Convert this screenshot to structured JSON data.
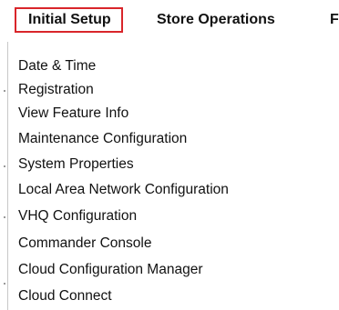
{
  "menubar": {
    "tabs": [
      {
        "label": "Initial Setup",
        "active": true
      },
      {
        "label": "Store Operations",
        "active": false
      },
      {
        "label": "F",
        "active": false
      }
    ]
  },
  "dropdown": {
    "items": [
      {
        "label": "Date & Time"
      },
      {
        "label": "Registration"
      },
      {
        "label": "View Feature Info"
      },
      {
        "label": "Maintenance Configuration"
      },
      {
        "label": "System Properties"
      },
      {
        "label": "Local Area Network Configuration"
      },
      {
        "label": "VHQ Configuration"
      },
      {
        "label": "Commander Console"
      },
      {
        "label": "Cloud Configuration Manager"
      },
      {
        "label": "Cloud Connect"
      }
    ]
  },
  "colors": {
    "active_tab_border": "#d9252a",
    "text": "#111111",
    "background": "#ffffff"
  }
}
